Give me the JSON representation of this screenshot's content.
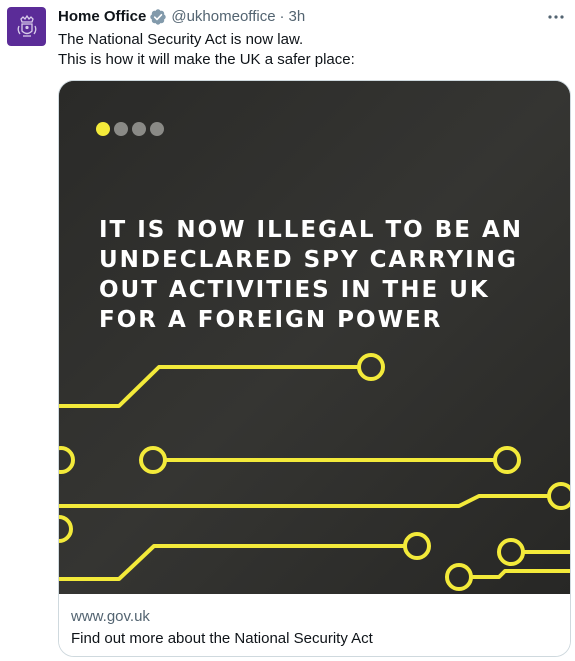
{
  "author": {
    "name": "Home Office",
    "handle": "@ukhomeoffice",
    "separator": "·",
    "time": "3h",
    "verified": true,
    "avatar_icon": "royal-crest-icon",
    "avatar_color": "#5b2c98",
    "verified_color": "#829aab"
  },
  "more_icon": "more-horizontal-icon",
  "tweet": {
    "lines": [
      "The National Security Act is now law.",
      "This is how it will make the UK a safer place:"
    ]
  },
  "card": {
    "image": {
      "background_color": "#2c2c2a",
      "accent_color": "#f3ea3a",
      "carousel_total": 4,
      "carousel_active": 1,
      "headline_lines": [
        "IT IS NOW ILLEGAL TO BE AN",
        "UNDECLARED SPY CARRYING",
        "OUT ACTIVITIES IN THE UK",
        "FOR A FOREIGN POWER"
      ]
    },
    "domain": "www.gov.uk",
    "title": "Find out more about the National Security Act"
  }
}
